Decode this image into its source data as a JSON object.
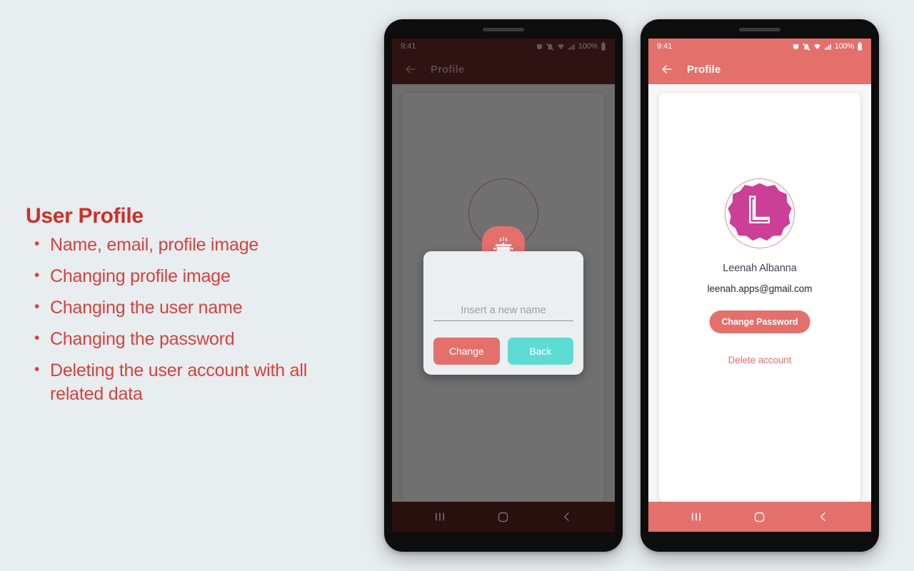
{
  "slide": {
    "title": "User Profile",
    "bullets": [
      "Name, email, profile image",
      "Changing profile image",
      "Changing the user name",
      "Changing the password",
      "Deleting the user account with all related data"
    ],
    "title_color": "#cf2d28",
    "bullet_color": "#d6423c",
    "background_color": "#e8edf0"
  },
  "status_bar": {
    "time": "9:41",
    "battery_percent": "100%",
    "icons": [
      "alarm-icon",
      "mute-icon",
      "wifi-icon",
      "signal-icon",
      "battery-icon"
    ]
  },
  "phone_one": {
    "label": "profile-screen-with-rename-dialog",
    "app_bar": {
      "title": "Profile",
      "back_icon": "back-arrow-icon",
      "background_color": "#6b2b2a"
    },
    "dialog": {
      "app_icon": "cooking-pot-icon",
      "input_placeholder": "Insert a new name",
      "input_value": "",
      "primary_button": "Change",
      "secondary_button": "Back",
      "primary_color": "#e4706b",
      "secondary_color": "#5ddcd4"
    },
    "nav_bar": {
      "recents": "recents-icon",
      "home": "home-icon",
      "back": "back-icon",
      "background_color": "#5c2524"
    }
  },
  "phone_two": {
    "label": "profile-screen",
    "app_bar": {
      "title": "Profile",
      "back_icon": "back-arrow-icon",
      "background_color": "#e4706b"
    },
    "profile": {
      "avatar_initial": "L",
      "avatar_color": "#cc3f96",
      "name": "Leenah Albanna",
      "email": "leenah.apps@gmail.com",
      "change_password_button": "Change Password",
      "delete_account_link": "Delete account",
      "accent_color": "#e4706b"
    },
    "nav_bar": {
      "recents": "recents-icon",
      "home": "home-icon",
      "back": "back-icon",
      "background_color": "#e4706b"
    }
  }
}
